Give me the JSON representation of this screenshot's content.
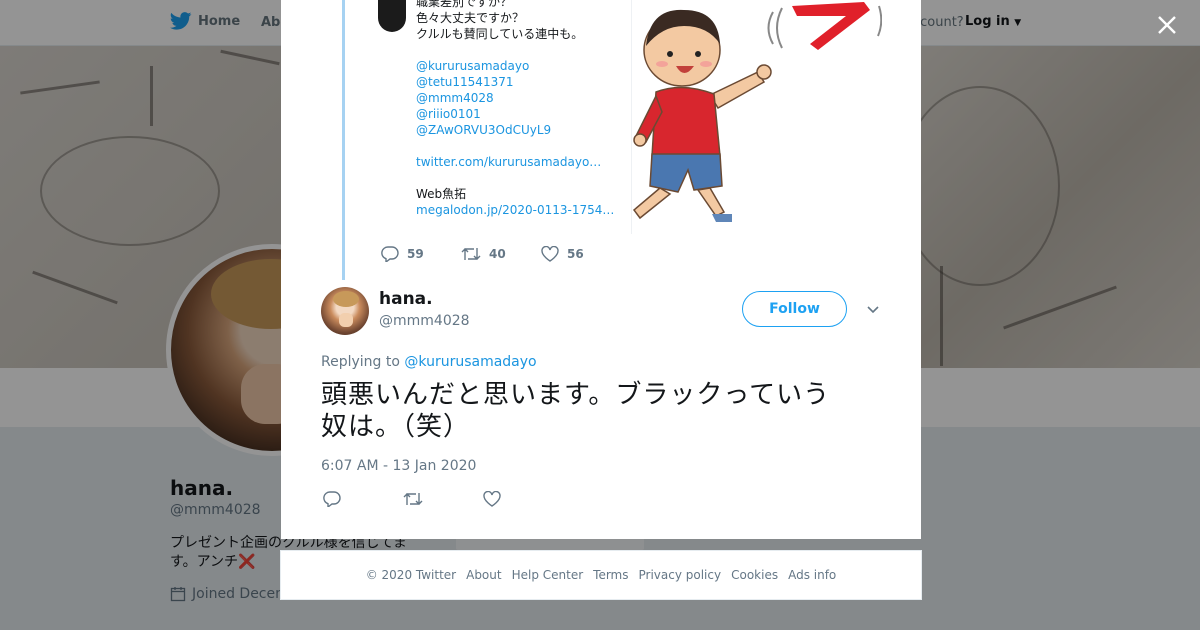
{
  "nav": {
    "home_label": "Home",
    "about_label": "Abo",
    "account_prompt": "account?",
    "login_label": "Log in"
  },
  "profile": {
    "name": "hana.",
    "handle": "@mmm4028",
    "bio": "プレゼント企画のクルル様を信じてます。アンチ",
    "bio_emoji": "❌",
    "joined": "Joined Decem",
    "card_text": "Ads info"
  },
  "quoted_tweet": {
    "lines": [
      {
        "text": "職業差別ですか？",
        "link": false
      },
      {
        "text": "色々大丈夫ですか？",
        "link": false
      },
      {
        "text": "クルルも賛同している連中も。",
        "link": false
      },
      {
        "text": "",
        "link": false
      },
      {
        "text": "@kururusamadayo",
        "link": true
      },
      {
        "text": "@tetu11541371",
        "link": true
      },
      {
        "text": "@mmm4028",
        "link": true
      },
      {
        "text": "@riiio0101",
        "link": true
      },
      {
        "text": "@ZAwORVU3OdCUyL9",
        "link": true
      },
      {
        "text": "",
        "link": false
      },
      {
        "text": "twitter.com/kururusamadayo…",
        "link": true
      },
      {
        "text": "",
        "link": false
      },
      {
        "text": "Web魚拓",
        "link": false
      },
      {
        "text": "megalodon.jp/2020-0113-1754…",
        "link": true
      }
    ]
  },
  "parent_actions": {
    "replies": "59",
    "retweets": "40",
    "likes": "56"
  },
  "tweet": {
    "name": "hana.",
    "handle": "@mmm4028",
    "follow_label": "Follow",
    "replying_prefix": "Replying to",
    "replying_to": "@kururusamadayo",
    "text_line1": "頭悪いんだと思います。ブラックっていう",
    "text_line2": "奴は。（笑）",
    "timestamp": "6:07 AM - 13 Jan 2020"
  },
  "footer": {
    "links": [
      "© 2020 Twitter",
      "About",
      "Help Center",
      "Terms",
      "Privacy policy",
      "Cookies",
      "Ads info"
    ]
  },
  "colors": {
    "brand": "#1da1f2",
    "link": "#1b95e0",
    "secondary_text": "#657786"
  }
}
